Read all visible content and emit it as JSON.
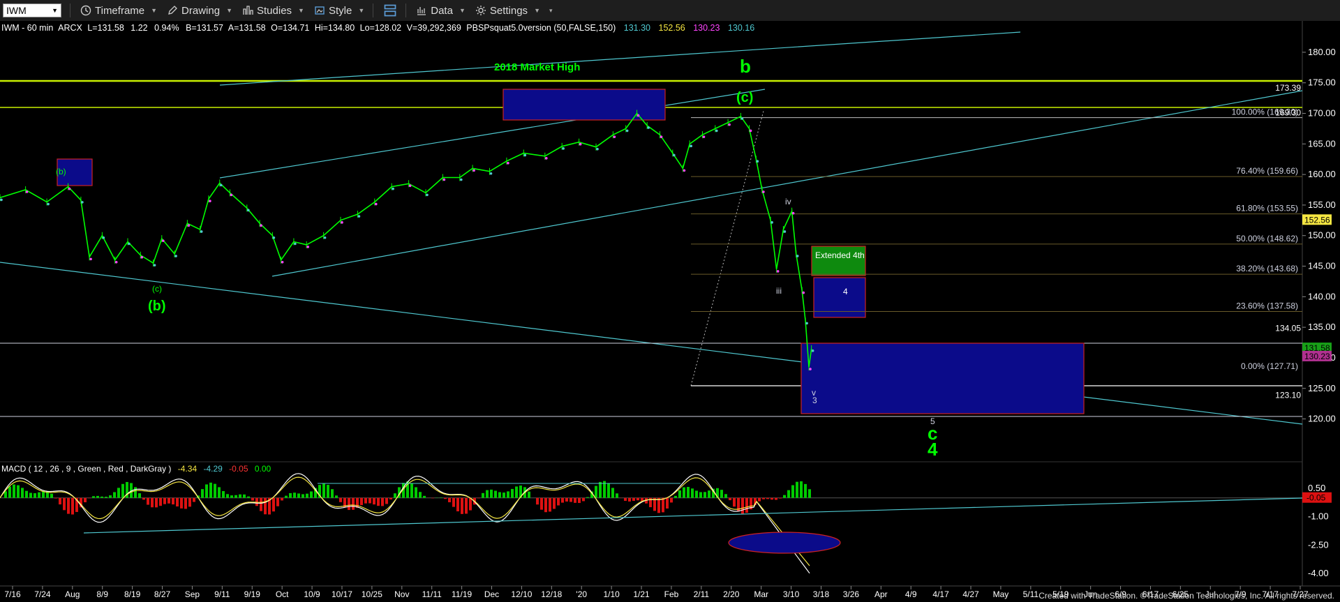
{
  "toolbar": {
    "symbol": "IWM",
    "timeframe": "Timeframe",
    "drawing": "Drawing",
    "studies": "Studies",
    "style": "Style",
    "data": "Data",
    "settings": "Settings"
  },
  "header": {
    "title": "IWM - 60 min",
    "exchange": "ARCX",
    "last": "L=131.58",
    "net": "1.22",
    "pct": "0.94%",
    "bid": "B=131.57",
    "ask": "A=131.58",
    "open": "O=134.71",
    "high": "Hi=134.80",
    "low": "Lo=128.02",
    "volume": "V=39,292,369",
    "study": "PBSPsquat5.0version (50,FALSE,150)",
    "v1": "131.30",
    "v2": "152.56",
    "v3": "130.23",
    "v4": "130.16"
  },
  "colors": {
    "price_up": "#00ff00",
    "price_down": "#ff00ff",
    "trendline": "#4fc8d0",
    "label_green": "#00ff00",
    "box_blue": "#0b0b8a",
    "box_border": "#cc2222",
    "fib_line": "#5a4a1a"
  },
  "chart_data": {
    "type": "line",
    "ylim": [
      115.5,
      182.5
    ],
    "yticks": [
      "180.00",
      "175.00",
      "170.00",
      "165.00",
      "160.00",
      "155.00",
      "150.00",
      "145.00",
      "140.00",
      "135.00",
      "130.00",
      "125.00",
      "120.00"
    ],
    "xticks": [
      "7/16",
      "7/24",
      "Aug",
      "8/9",
      "8/19",
      "8/27",
      "Sep",
      "9/11",
      "9/19",
      "Oct",
      "10/9",
      "10/17",
      "10/25",
      "Nov",
      "11/11",
      "11/19",
      "Dec",
      "12/10",
      "12/18",
      "'20",
      "1/10",
      "1/21",
      "Feb",
      "2/11",
      "2/20",
      "Mar",
      "3/10",
      "3/18",
      "3/26",
      "Apr",
      "4/9",
      "4/17",
      "4/27",
      "May",
      "5/11",
      "5/19",
      "Jun",
      "6/9",
      "6/17",
      "6/25",
      "Jul",
      "7/9",
      "7/17",
      "7/27"
    ],
    "price_series": [
      [
        0,
        156.2
      ],
      [
        30,
        157.5
      ],
      [
        55,
        155.5
      ],
      [
        80,
        158.0
      ],
      [
        95,
        155.8
      ],
      [
        105,
        146.5
      ],
      [
        120,
        150.0
      ],
      [
        135,
        146.0
      ],
      [
        150,
        149.0
      ],
      [
        165,
        146.8
      ],
      [
        180,
        145.5
      ],
      [
        190,
        149.5
      ],
      [
        205,
        147.0
      ],
      [
        220,
        152.0
      ],
      [
        235,
        151.0
      ],
      [
        245,
        156.0
      ],
      [
        258,
        158.6
      ],
      [
        270,
        157.0
      ],
      [
        290,
        154.5
      ],
      [
        305,
        152.0
      ],
      [
        320,
        150.0
      ],
      [
        330,
        146.0
      ],
      [
        345,
        149.0
      ],
      [
        360,
        148.5
      ],
      [
        380,
        150.0
      ],
      [
        400,
        152.5
      ],
      [
        420,
        153.5
      ],
      [
        440,
        155.5
      ],
      [
        460,
        158.0
      ],
      [
        480,
        158.5
      ],
      [
        500,
        157.0
      ],
      [
        520,
        159.5
      ],
      [
        540,
        159.5
      ],
      [
        555,
        161.0
      ],
      [
        575,
        160.5
      ],
      [
        595,
        162.2
      ],
      [
        615,
        163.5
      ],
      [
        640,
        163.0
      ],
      [
        660,
        164.6
      ],
      [
        680,
        165.3
      ],
      [
        700,
        164.5
      ],
      [
        720,
        166.5
      ],
      [
        735,
        167.5
      ],
      [
        748,
        170.0
      ],
      [
        760,
        168.0
      ],
      [
        775,
        166.5
      ],
      [
        790,
        163.5
      ],
      [
        802,
        161.0
      ],
      [
        810,
        165.0
      ],
      [
        825,
        166.5
      ],
      [
        840,
        167.5
      ],
      [
        855,
        168.5
      ],
      [
        870,
        169.5
      ],
      [
        880,
        167.5
      ],
      [
        888,
        162.5
      ],
      [
        895,
        157.5
      ],
      [
        905,
        152.5
      ],
      [
        912,
        144.5
      ],
      [
        920,
        151.0
      ],
      [
        930,
        154.0
      ],
      [
        935,
        147.0
      ],
      [
        942,
        141.0
      ],
      [
        946,
        136.0
      ],
      [
        950,
        128.5
      ],
      [
        953,
        131.5
      ]
    ],
    "price_labels": [
      "180.00",
      "175.00",
      "170.00",
      "165.00",
      "160.00",
      "155.00",
      "150.00",
      "145.00",
      "140.00",
      "135.00",
      "130.00",
      "125.00",
      "120.00"
    ],
    "fib_levels": [
      {
        "label": "100.00% (169.30)",
        "value": 169.3
      },
      {
        "label": "76.40% (159.66)",
        "value": 159.66
      },
      {
        "label": "61.80% (153.55)",
        "value": 153.55
      },
      {
        "label": "50.00% (148.62)",
        "value": 148.62
      },
      {
        "label": "38.20% (143.68)",
        "value": 143.68
      },
      {
        "label": "23.60% (137.58)",
        "value": 137.58
      },
      {
        "label": "0.00% (127.71)",
        "value": 127.71
      }
    ],
    "price_markers": [
      {
        "label": "173.39",
        "value": 173.39
      },
      {
        "label": "169.30",
        "value": 169.3
      },
      {
        "label": "134.05",
        "value": 134.05
      },
      {
        "label": "123.10",
        "value": 123.1
      }
    ],
    "price_tags": [
      {
        "label": "152.56",
        "value": 152.56,
        "color": "#f5e642"
      },
      {
        "label": "131.58",
        "value": 131.58,
        "color": "#18a018"
      },
      {
        "label": "130.23",
        "value": 130.23,
        "color": "#b03090"
      }
    ],
    "annotations": {
      "market_high": "2018 Market High",
      "wave_b": "b",
      "wave_c_paren": "(c)",
      "wave_b_paren": "(b)",
      "wave_b_small": "(b)",
      "wave_c_small": "(c)",
      "wave_iii": "iii",
      "wave_iv": "iv",
      "wave_v": "v",
      "wave_3": "3",
      "wave_5": "5",
      "wave_C": "c",
      "wave_4_big": "4",
      "box_extended": "Extended 4th",
      "box_4": "4"
    },
    "macd": {
      "title": "MACD ( 12 , 26 , 9 , Green , Red , DarkGray )",
      "values": [
        "-4.34",
        "-4.29",
        "-0.05",
        "0.00"
      ],
      "ylim": [
        -4.6,
        1.1
      ],
      "yticks": [
        "0.50",
        "-1.00",
        "-2.50",
        "-4.00"
      ],
      "tag": "-0.05"
    }
  },
  "footer": "Created with TradeStation. ©TradeStation Technologies, Inc. All rights reserved."
}
